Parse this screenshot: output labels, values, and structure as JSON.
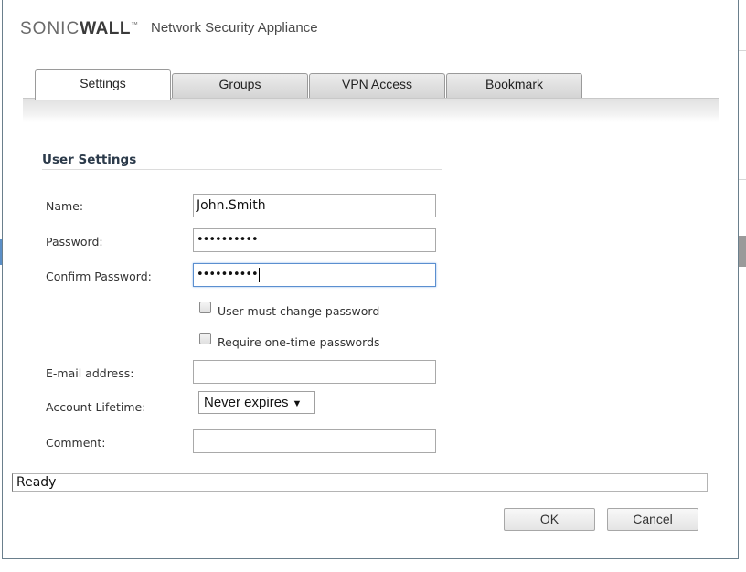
{
  "header": {
    "logo_light": "SONIC",
    "logo_bold": "WALL",
    "logo_tm": "™",
    "product": "Network Security Appliance"
  },
  "tabs": [
    {
      "label": "Settings",
      "active": true
    },
    {
      "label": "Groups",
      "active": false
    },
    {
      "label": "VPN Access",
      "active": false
    },
    {
      "label": "Bookmark",
      "active": false
    }
  ],
  "section": {
    "title": "User Settings"
  },
  "form": {
    "name_label": "Name:",
    "name_value": "John.Smith",
    "password_label": "Password:",
    "password_value": "••••••••••",
    "confirm_label": "Confirm Password:",
    "confirm_value": "••••••••••",
    "must_change_label": "User must change password",
    "must_change_checked": false,
    "otp_label": "Require one-time passwords",
    "otp_checked": false,
    "email_label": "E-mail address:",
    "email_value": "",
    "lifetime_label": "Account Lifetime:",
    "lifetime_value": "Never expires",
    "lifetime_arrow": "▼",
    "comment_label": "Comment:",
    "comment_value": ""
  },
  "status": {
    "text": "Ready"
  },
  "buttons": {
    "ok": "OK",
    "cancel": "Cancel"
  },
  "colors": {
    "dialog_border": "#6a7f8c",
    "focus_border": "#5b8fd0",
    "section_title": "#2b3a4a"
  }
}
